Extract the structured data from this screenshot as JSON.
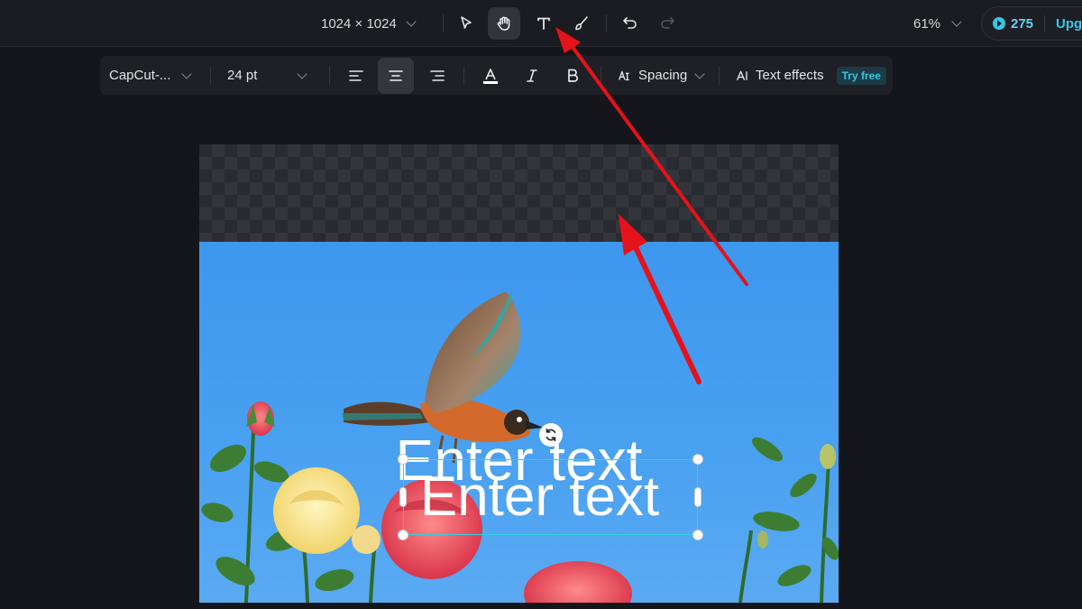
{
  "topbar": {
    "canvas_size": "1024 × 1024",
    "zoom": "61%",
    "credits": "275",
    "upgrade_label": "Upgra"
  },
  "textbar": {
    "font": "CapCut-...",
    "font_size": "24 pt",
    "spacing_label": "Spacing",
    "text_effects_label": "Text effects",
    "try_free_label": "Try free"
  },
  "canvas": {
    "text_layer_1": "Enter text",
    "text_layer_2": "Enter text"
  },
  "colors": {
    "accent": "#38c5e8",
    "selection": "#33d0e0",
    "annotation_arrow": "#e5121a"
  }
}
